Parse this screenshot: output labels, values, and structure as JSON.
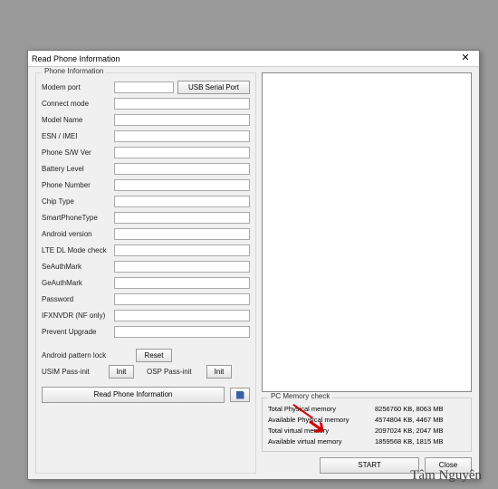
{
  "window": {
    "title": "Read Phone Information"
  },
  "group_info": {
    "title": "Phone Information",
    "modem_port_label": "Modem port",
    "usb_serial_btn": "USB Serial Port",
    "fields": [
      {
        "label": "Connect mode"
      },
      {
        "label": "Model Name"
      },
      {
        "label": "ESN / IMEI"
      },
      {
        "label": "Phone S/W Ver"
      },
      {
        "label": "Battery Level"
      },
      {
        "label": "Phone Number"
      },
      {
        "label": "Chip Type"
      },
      {
        "label": "SmartPhoneType"
      },
      {
        "label": "Android version"
      },
      {
        "label": "LTE DL Mode check"
      },
      {
        "label": "SeAuthMark"
      },
      {
        "label": "GeAuthMark"
      },
      {
        "label": "Password"
      },
      {
        "label": "IFXNVDR (NF only)"
      },
      {
        "label": "Prevent Upgrade"
      }
    ],
    "pattern_lock_label": "Android pattern lock",
    "reset_btn": "Reset",
    "usim_label": "USIM Pass-init",
    "init_btn": "Init",
    "osp_label": "OSP Pass-init",
    "init2_btn": "Init",
    "read_btn": "Read Phone Information"
  },
  "memory": {
    "title": "PC Memory check",
    "rows": [
      {
        "l": "Total Physical memory",
        "v": "8256760 KB,  8063 MB"
      },
      {
        "l": "Available Physical memory",
        "v": "4574804 KB,  4467 MB"
      },
      {
        "l": "Total virtual memory",
        "v": "2097024 KB,  2047 MB"
      },
      {
        "l": "Available virtual memory",
        "v": "1859568 KB,  1815 MB"
      }
    ]
  },
  "buttons": {
    "start": "START",
    "close": "Close"
  },
  "signature": "Tâm Nguyên"
}
